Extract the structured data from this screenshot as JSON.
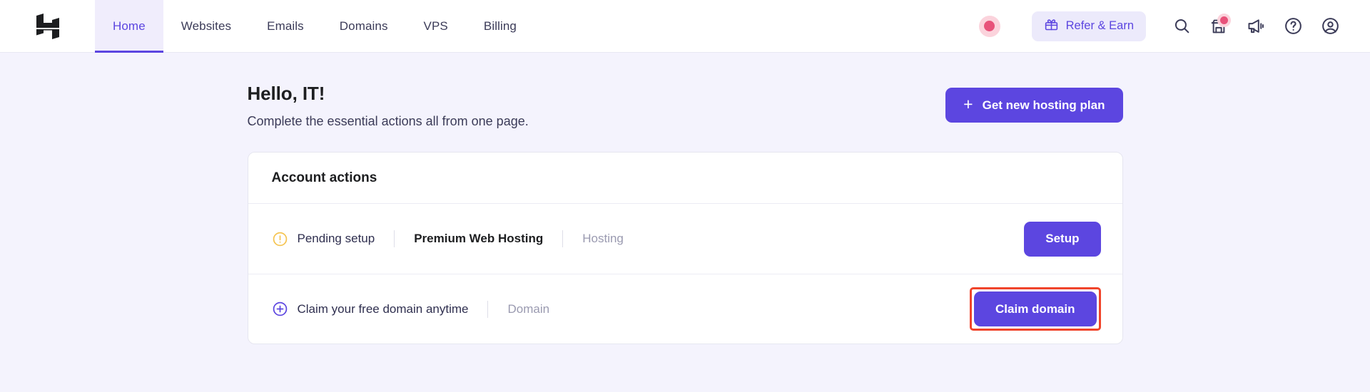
{
  "header": {
    "logo_icon": "hostinger-h-logo",
    "nav": [
      {
        "label": "Home",
        "active": true
      },
      {
        "label": "Websites",
        "active": false
      },
      {
        "label": "Emails",
        "active": false
      },
      {
        "label": "Domains",
        "active": false
      },
      {
        "label": "VPS",
        "active": false
      },
      {
        "label": "Billing",
        "active": false
      }
    ],
    "record_indicator": "record-dot-indicator",
    "refer": {
      "label": "Refer & Earn",
      "icon": "gift-icon"
    },
    "icons": [
      {
        "name": "search-icon",
        "badge": false
      },
      {
        "name": "marketplace-storefront-icon",
        "badge": true
      },
      {
        "name": "megaphone-announcement-icon",
        "badge": false
      },
      {
        "name": "help-circle-icon",
        "badge": false
      },
      {
        "name": "account-avatar-icon",
        "badge": false
      }
    ]
  },
  "page": {
    "title": "Hello, IT!",
    "subtitle": "Complete the essential actions all from one page.",
    "cta": {
      "label": "Get new hosting plan",
      "icon": "plus-icon"
    }
  },
  "card": {
    "title": "Account actions",
    "rows": [
      {
        "status_icon": "warning-exclamation-circle-icon",
        "status": "Pending setup",
        "name": "Premium Web Hosting",
        "type": "Hosting",
        "action": "Setup",
        "highlighted": false
      },
      {
        "status_icon": "plus-circle-icon",
        "status": "Claim your free domain anytime",
        "name": "",
        "type": "Domain",
        "action": "Claim domain",
        "highlighted": true
      }
    ]
  },
  "colors": {
    "accent": "#5c46e0",
    "accent_soft": "#eceafb",
    "page_bg": "#f4f3fd",
    "warning": "#f5c451",
    "notification": "#e8527a",
    "highlight_outline": "#f0442a"
  }
}
